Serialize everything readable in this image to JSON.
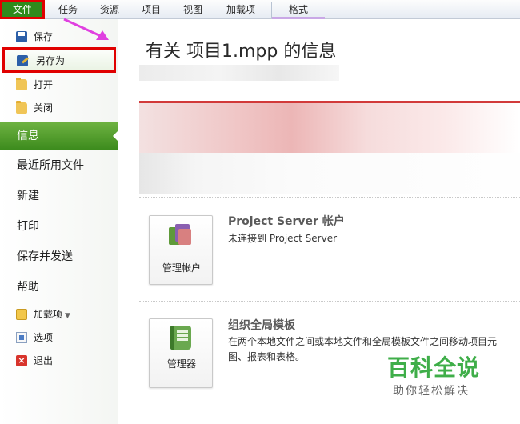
{
  "ribbon": {
    "tabs": [
      "文件",
      "任务",
      "资源",
      "项目",
      "视图",
      "加载项",
      "格式"
    ]
  },
  "sidebar": {
    "commands": [
      {
        "label": "保存",
        "icon": "save-icon"
      },
      {
        "label": "另存为",
        "icon": "save-as-icon"
      },
      {
        "label": "打开",
        "icon": "open-folder-icon"
      },
      {
        "label": "关闭",
        "icon": "close-folder-icon"
      }
    ],
    "nav": [
      "信息",
      "最近所用文件",
      "新建",
      "打印",
      "保存并发送",
      "帮助"
    ],
    "footer": [
      {
        "label": "加载项",
        "icon": "add-ins-icon",
        "dropdown": true
      },
      {
        "label": "选项",
        "icon": "options-icon"
      },
      {
        "label": "退出",
        "icon": "exit-icon"
      }
    ],
    "active_nav": "信息"
  },
  "main": {
    "title": "有关 项目1.mpp 的信息",
    "sections": [
      {
        "button_label": "管理帐户",
        "heading": "Project Server 帐户",
        "description": "未连接到 Project Server"
      },
      {
        "button_label": "管理器",
        "heading": "组织全局模板",
        "description_line1": "在两个本地文件之间或本地文件和全局模板文件之间移动项目元",
        "description_line2": "图、报表和表格。"
      }
    ]
  },
  "watermark": {
    "big": "百科全说",
    "small": "助你轻松解决"
  },
  "colors": {
    "file_tab": "#2f8a1c",
    "active_nav": "#4f9e2a",
    "highlight_border": "#e00000",
    "arrow": "#e040e0"
  }
}
